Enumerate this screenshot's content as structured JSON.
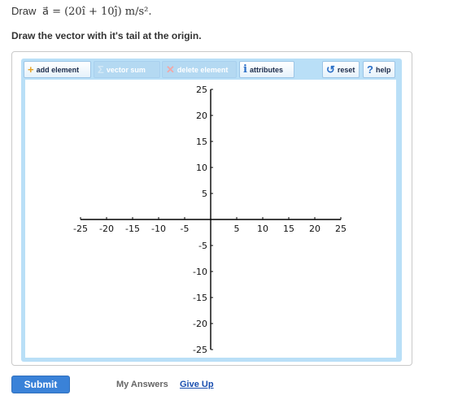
{
  "problem": {
    "prefix": "Draw",
    "formula": "a⃗ = (20î + 10ĵ) m/s².",
    "instruction": "Draw the vector with it's tail at the origin."
  },
  "toolbar": {
    "add_element": "add element",
    "vector_sum": "vector sum",
    "delete_element": "delete element",
    "attributes": "attributes",
    "reset": "reset",
    "help": "help"
  },
  "graph": {
    "x_range": [
      -25,
      25
    ],
    "y_range": [
      -25,
      25
    ],
    "x_ticks": [
      "-25",
      "-20",
      "-15",
      "-10",
      "-5",
      "5",
      "10",
      "15",
      "20",
      "25"
    ],
    "y_ticks": [
      "25",
      "20",
      "15",
      "10",
      "5",
      "-5",
      "-10",
      "-15",
      "-20",
      "-25"
    ]
  },
  "footer": {
    "submit": "Submit",
    "my_answers": "My Answers",
    "give_up": "Give Up"
  }
}
